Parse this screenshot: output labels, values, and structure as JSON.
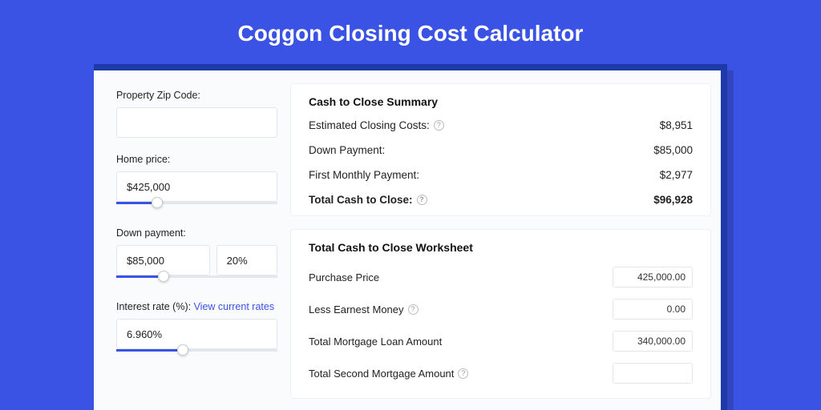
{
  "page": {
    "title": "Coggon Closing Cost Calculator"
  },
  "left": {
    "zip_label": "Property Zip Code:",
    "zip_value": "",
    "home_price_label": "Home price:",
    "home_price_value": "$425,000",
    "down_payment_label": "Down payment:",
    "down_payment_amount": "$85,000",
    "down_payment_pct": "20%",
    "interest_label": "Interest rate (%): ",
    "interest_link": "View current rates",
    "interest_value": "6.960%"
  },
  "sliders": {
    "home_price_pct": 22,
    "down_payment_pct": 26,
    "interest_pct": 38
  },
  "summary": {
    "title": "Cash to Close Summary",
    "rows": [
      {
        "label": "Estimated Closing Costs:",
        "value": "$8,951",
        "help": true
      },
      {
        "label": "Down Payment:",
        "value": "$85,000",
        "help": false
      },
      {
        "label": "First Monthly Payment:",
        "value": "$2,977",
        "help": false
      }
    ],
    "total_label": "Total Cash to Close:",
    "total_value": "$96,928"
  },
  "worksheet": {
    "title": "Total Cash to Close Worksheet",
    "rows": [
      {
        "label": "Purchase Price",
        "value": "425,000.00",
        "help": false
      },
      {
        "label": "Less Earnest Money",
        "value": "0.00",
        "help": true
      },
      {
        "label": "Total Mortgage Loan Amount",
        "value": "340,000.00",
        "help": false
      },
      {
        "label": "Total Second Mortgage Amount",
        "value": "",
        "help": true
      }
    ]
  }
}
